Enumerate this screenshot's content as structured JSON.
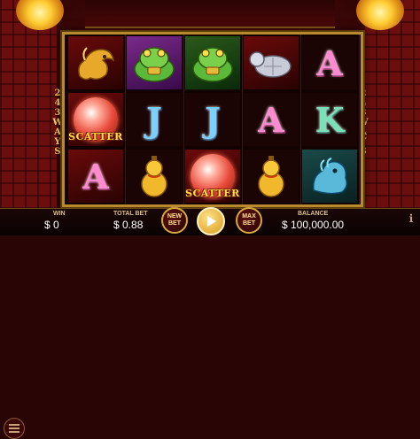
{
  "game": {
    "ways_label_left": [
      "2",
      "4",
      "3",
      "W",
      "A",
      "Y",
      "S"
    ],
    "ways_label_right": [
      "2",
      "4",
      "3",
      "W",
      "A",
      "Y",
      "S"
    ]
  },
  "reels": [
    [
      {
        "symbol": "dragon",
        "bg": "red"
      },
      {
        "symbol": "scatter",
        "label": "SCATTER",
        "bg": "red"
      },
      {
        "symbol": "letter",
        "text": "A",
        "style": "a",
        "bg": "red"
      }
    ],
    [
      {
        "symbol": "toad",
        "bg": "purple"
      },
      {
        "symbol": "letter",
        "text": "J",
        "style": "j",
        "bg": "dark"
      },
      {
        "symbol": "gourd",
        "bg": "dark"
      }
    ],
    [
      {
        "symbol": "toad",
        "bg": "green"
      },
      {
        "symbol": "letter",
        "text": "J",
        "style": "j",
        "bg": "dark"
      },
      {
        "symbol": "scatter",
        "label": "SCATTER",
        "bg": "red"
      }
    ],
    [
      {
        "symbol": "turtle",
        "bg": "red"
      },
      {
        "symbol": "letter",
        "text": "A",
        "style": "a",
        "bg": "dark"
      },
      {
        "symbol": "gourd",
        "bg": "dark"
      }
    ],
    [
      {
        "symbol": "letter",
        "text": "A",
        "style": "a",
        "bg": "dark"
      },
      {
        "symbol": "letter",
        "text": "K",
        "style": "k",
        "bg": "dark"
      },
      {
        "symbol": "lion",
        "bg": "teal"
      }
    ]
  ],
  "bottom": {
    "win_label": "WIN",
    "win_value": "$ 0",
    "total_bet_label": "TOTAL BET",
    "total_bet_value": "$ 0.88",
    "new_bet_label": "NEW\nBET",
    "max_bet_label": "MAX\nBET",
    "balance_label": "BALANCE",
    "balance_value": "$ 100,000.00",
    "info_glyph": "i"
  },
  "colors": {
    "frame_gold": "#b88a2e",
    "label_gold": "#d8c08a"
  }
}
